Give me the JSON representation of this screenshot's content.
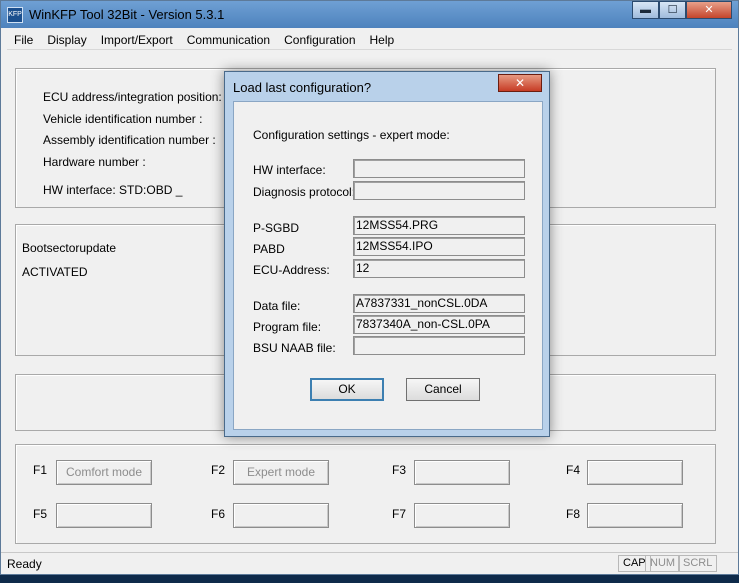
{
  "window": {
    "title": "WinKFP Tool 32Bit - Version 5.3.1",
    "controls": {
      "minimize": "▬",
      "maximize": "☐",
      "close": "✕"
    }
  },
  "menu": [
    "File",
    "Display",
    "Import/Export",
    "Communication",
    "Configuration",
    "Help"
  ],
  "info": {
    "ecu_address": "ECU address/integration position:",
    "vehicle_id": "Vehicle identification number :",
    "assembly_id": "Assembly identification number :",
    "hardware_number": "Hardware number :",
    "hw_interface": "HW interface:  STD:OBD _"
  },
  "boot": {
    "title": "Bootsectorupdate",
    "status": "ACTIVATED"
  },
  "fkeys": [
    {
      "key": "F1",
      "label": "Comfort mode"
    },
    {
      "key": "F2",
      "label": "Expert mode"
    },
    {
      "key": "F3",
      "label": ""
    },
    {
      "key": "F4",
      "label": ""
    },
    {
      "key": "F5",
      "label": ""
    },
    {
      "key": "F6",
      "label": ""
    },
    {
      "key": "F7",
      "label": ""
    },
    {
      "key": "F8",
      "label": ""
    }
  ],
  "status": {
    "text": "Ready",
    "cap": "CAP",
    "num": "NUM",
    "scrl": "SCRL"
  },
  "dialog": {
    "title": "Load last configuration?",
    "close": "✕",
    "heading": "Configuration settings - expert mode:",
    "fields": {
      "hw_interface": {
        "label": "HW interface:",
        "value": ""
      },
      "diagnosis_protocol": {
        "label": "Diagnosis protocol:",
        "value": ""
      },
      "p_sgbd": {
        "label": "P-SGBD",
        "value": "12MSS54.PRG"
      },
      "pabd": {
        "label": "PABD",
        "value": "12MSS54.IPO"
      },
      "ecu_address": {
        "label": "ECU-Address:",
        "value": "12"
      },
      "data_file": {
        "label": "Data file:",
        "value": "A7837331_nonCSL.0DA"
      },
      "program_file": {
        "label": "Program file:",
        "value": "7837340A_non-CSL.0PA"
      },
      "bsu_naab_file": {
        "label": "BSU NAAB file:",
        "value": ""
      }
    },
    "ok": "OK",
    "cancel": "Cancel"
  }
}
